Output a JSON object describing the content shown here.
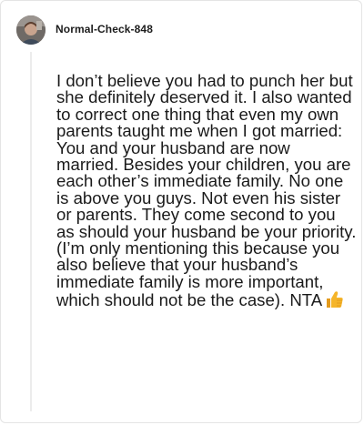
{
  "comment": {
    "username": "Normal-Check-848",
    "body": "I don’t believe you had to punch her but she definitely deserved it. I also wanted to correct one thing that even my own parents taught me when I got married: You and your husband are now married. Besides your children, you are each other’s immediate family. No one is above you guys. Not even his sister or parents. They come second to you as should your husband be your priority. (I’m only mentioning this because you also believe that your husband’s immediate family is more important, which should not be the case). NTA",
    "trailing_emoji": "thumbs-up-icon"
  },
  "colors": {
    "text": "#1a1a1a",
    "username": "#1c1c1c",
    "thread_line": "#ececec",
    "emoji": "#f5b52a"
  }
}
